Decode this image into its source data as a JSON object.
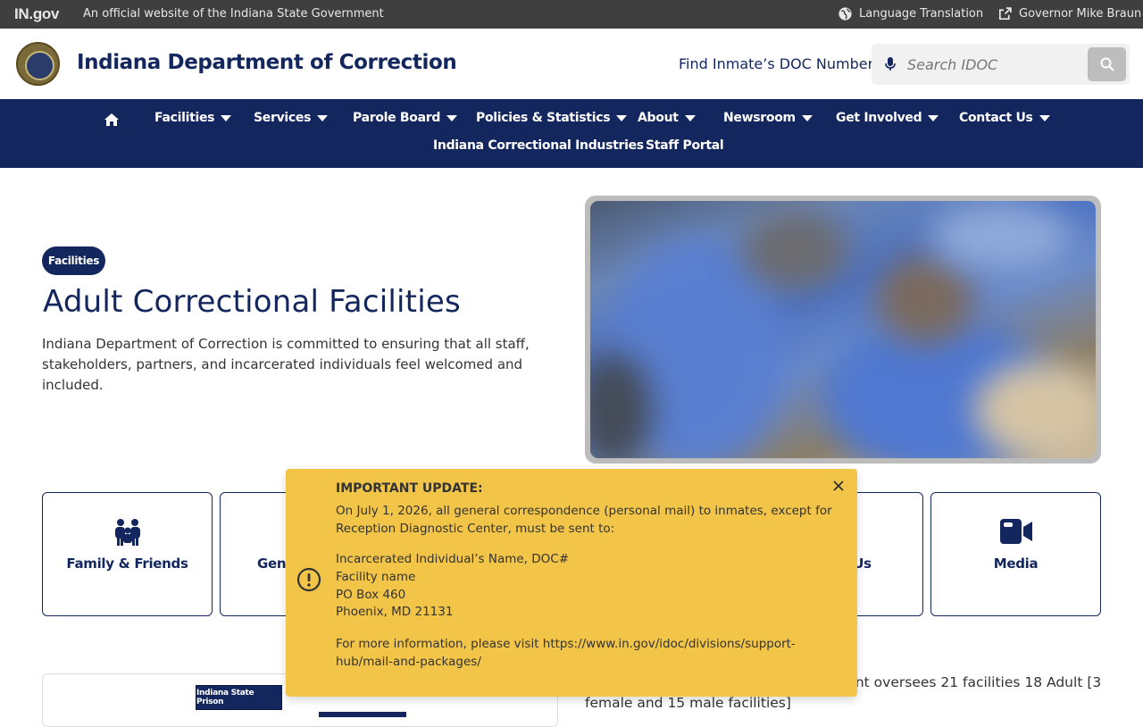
{
  "topbar": {
    "logo": "IN.gov",
    "official": "An official website of the Indiana State Government",
    "language": "Language Translation",
    "governor": "Governor Mike Braun"
  },
  "header": {
    "title": "Indiana Department of Correction",
    "find_inmate": "Find Inmate’s DOC Number",
    "search_placeholder": "Search IDOC"
  },
  "nav": {
    "row1": [
      "Facilities",
      "Services",
      "Parole Board",
      "Policies & Statistics",
      "About",
      "Newsroom",
      "Get Involved",
      "Contact Us"
    ],
    "row2": [
      "Indiana Correctional Industries",
      "Staff Portal"
    ]
  },
  "hero": {
    "pill": "Facilities",
    "title": "Adult Correctional Facilities",
    "description": "Indiana Department of Correction is committed to ensuring that all staff, stakeholders, partners, and incarcerated individuals feel welcomed and included."
  },
  "cards": [
    {
      "label": "Family & Friends",
      "icon": "family-icon"
    },
    {
      "label": "Gene",
      "icon": "hidden"
    },
    {
      "label": "n Us",
      "icon": "hidden"
    },
    {
      "label": "Media",
      "icon": "video-camera-icon"
    }
  ],
  "map": {
    "label": "Indiana State Prison"
  },
  "body_text": "epartment of Correction, the department oversees 21 facilities 18 Adult [3 female and 15 male facilities]",
  "alert": {
    "heading": "IMPORTANT UPDATE:",
    "line1": "On July 1, 2026, all general correspondence (personal mail) to inmates, except for Reception Diagnostic Center, must be sent to:",
    "addr1": "Incarcerated Individual’s Name, DOC#",
    "addr2": "Facility name",
    "addr3": "PO Box 460",
    "addr4": "Phoenix, MD 21131",
    "more": "For more information, please visit https://www.in.gov/idoc/divisions/support-hub/mail-and-packages/"
  },
  "colors": {
    "navy": "#13275e",
    "alert": "#f2c447",
    "topbar": "#3f3f3f"
  }
}
